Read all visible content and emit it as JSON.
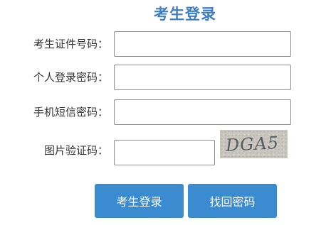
{
  "title": "考生登录",
  "fields": [
    {
      "label": "考生证件号码：",
      "value": "",
      "placeholder": ""
    },
    {
      "label": "个人登录密码：",
      "value": "",
      "placeholder": ""
    },
    {
      "label": "手机短信密码：",
      "value": "",
      "placeholder": ""
    },
    {
      "label": "图片验证码：",
      "value": "",
      "placeholder": ""
    }
  ],
  "captcha": {
    "code": "DGA5"
  },
  "buttons": {
    "login": "考生登录",
    "recover": "找回密码"
  },
  "colors": {
    "accent": "#3b8bd0",
    "title": "#3d7fc4",
    "field_border": "#8f8f8f"
  }
}
